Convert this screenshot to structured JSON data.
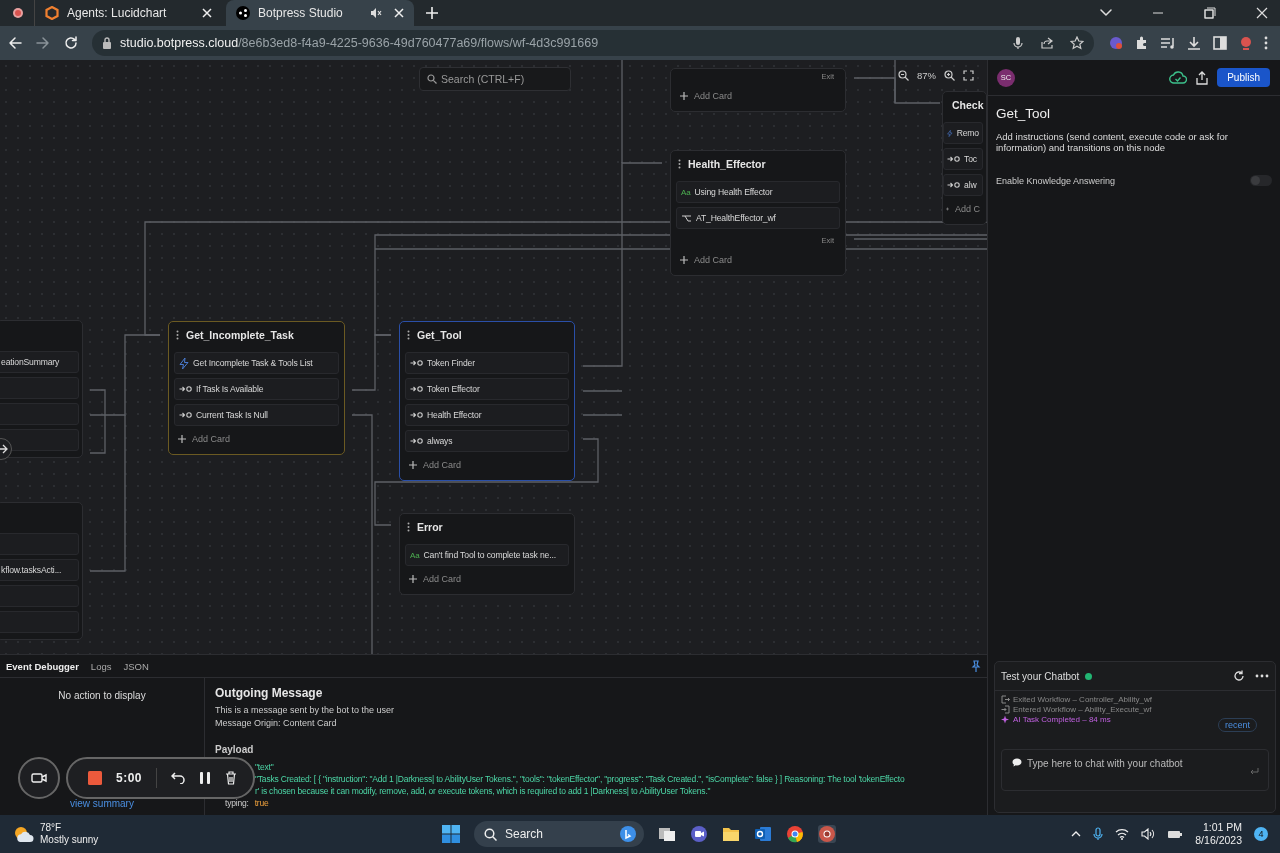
{
  "browser": {
    "tabs": [
      {
        "title": "Agents: Lucidchart",
        "selected": false,
        "muted": false
      },
      {
        "title": "Botpress Studio",
        "selected": true,
        "muted": true
      }
    ],
    "url": {
      "host": "studio.botpress.cloud",
      "path": "/8e6b3ed8-f4a9-4225-9636-49d760477a69/flows/wf-4d3c991669"
    }
  },
  "canvas": {
    "search": {
      "placeholder": "Search (CTRL+F)"
    },
    "zoom": "87%",
    "nodes": [
      {
        "exit": "Exit",
        "add_card": "Add Card",
        "selected": false,
        "entry": false
      },
      {
        "title": "Health_Effector",
        "cards": [
          {
            "kind": "text",
            "icon": "Aa",
            "label": "Using Health Effector"
          },
          {
            "kind": "workflow",
            "label": "AT_HealthEffector_wf"
          }
        ],
        "exit": "Exit",
        "add_card": "Add Card",
        "selected": false,
        "entry": false
      },
      {
        "title": "Check",
        "cards": [
          {
            "kind": "execute",
            "label": "Remo"
          },
          {
            "kind": "transition",
            "label": "Toc"
          },
          {
            "kind": "transition",
            "label": "alw"
          }
        ],
        "add_card": "Add C",
        "selected": false,
        "entry": false
      },
      {
        "cards": [
          {
            "kind": "plain",
            "label": "eationSummary"
          },
          {
            "kind": "blank"
          },
          {
            "kind": "blank"
          },
          {
            "kind": "blank"
          }
        ],
        "selected": false,
        "entry": false
      },
      {
        "title": "Get_Incomplete_Task",
        "cards": [
          {
            "kind": "execute",
            "label": "Get Incomplete Task & Tools List"
          },
          {
            "kind": "transition",
            "label": "If Task Is Available"
          },
          {
            "kind": "transition",
            "label": "Current Task Is Null"
          }
        ],
        "add_card": "Add Card",
        "selected": false,
        "entry": true
      },
      {
        "title": "Get_Tool",
        "cards": [
          {
            "kind": "transition",
            "label": "Token Finder"
          },
          {
            "kind": "transition",
            "label": "Token Effector"
          },
          {
            "kind": "transition",
            "label": "Health Effector"
          },
          {
            "kind": "transition",
            "label": "always"
          }
        ],
        "add_card": "Add Card",
        "selected": true,
        "entry": false
      },
      {
        "title": "Error",
        "cards": [
          {
            "kind": "text",
            "icon": "Aa",
            "label": "Can't find Tool to complete task ne..."
          }
        ],
        "add_card": "Add Card",
        "selected": false,
        "entry": false
      },
      {
        "cards": [
          {
            "kind": "blank"
          },
          {
            "kind": "plain",
            "label": "kflow.tasksActi..."
          },
          {
            "kind": "blank"
          },
          {
            "kind": "blank"
          }
        ],
        "selected": false,
        "entry": false
      }
    ]
  },
  "debugger": {
    "tabs": [
      {
        "label": "Event Debugger",
        "selected": true
      },
      {
        "label": "Logs",
        "selected": false
      },
      {
        "label": "JSON",
        "selected": false
      }
    ],
    "empty": "No action to display",
    "summary_link": "view summary",
    "heading": "Outgoing Message",
    "description": "This is a message sent by the bot to the user",
    "origin": "Message Origin: Content Card",
    "payload_label": "Payload",
    "payload": [
      {
        "kind": "string",
        "value": "\"text\""
      },
      {
        "kind": "string",
        "value": "\"Tasks Created: [ { \"instruction\": \"Add 1 |Darkness| to AbilityUser Tokens.\", \"tools\": \"tokenEffector\", \"progress\": \"Task Created.\", \"isComplete\": false } ] Reasoning: The tool 'tokenEffecto"
      },
      {
        "kind": "string",
        "value": "r' is chosen because it can modify, remove, add, or execute tokens, which is required to add 1 |Darkness| to AbilityUser Tokens.\""
      },
      {
        "kind": "boolean",
        "key": "typing:",
        "value": "true"
      }
    ]
  },
  "inspector": {
    "avatar": "SC",
    "publish": "Publish",
    "title": "Get_Tool",
    "description": "Add instructions (send content, execute code or ask for information) and transitions on this node",
    "toggle": {
      "label": "Enable Knowledge Answering",
      "on": false
    }
  },
  "chat": {
    "title": "Test your Chatbot",
    "online": true,
    "events": [
      {
        "kind": "exit",
        "text": "Exited Workflow – Controller_Ability_wf"
      },
      {
        "kind": "enter",
        "text": "Entered Workflow – Ability_Execute_wf"
      },
      {
        "kind": "ai",
        "text": "AI Task Completed – 84 ms"
      }
    ],
    "recent": "recent",
    "placeholder": "Type here to chat with your chatbot"
  },
  "recorder": {
    "timer": "5:00"
  },
  "taskbar": {
    "temperature": "78°F",
    "weather": "Mostly sunny",
    "search": "Search",
    "time": "1:01 PM",
    "date": "8/16/2023",
    "notifications": "4"
  }
}
